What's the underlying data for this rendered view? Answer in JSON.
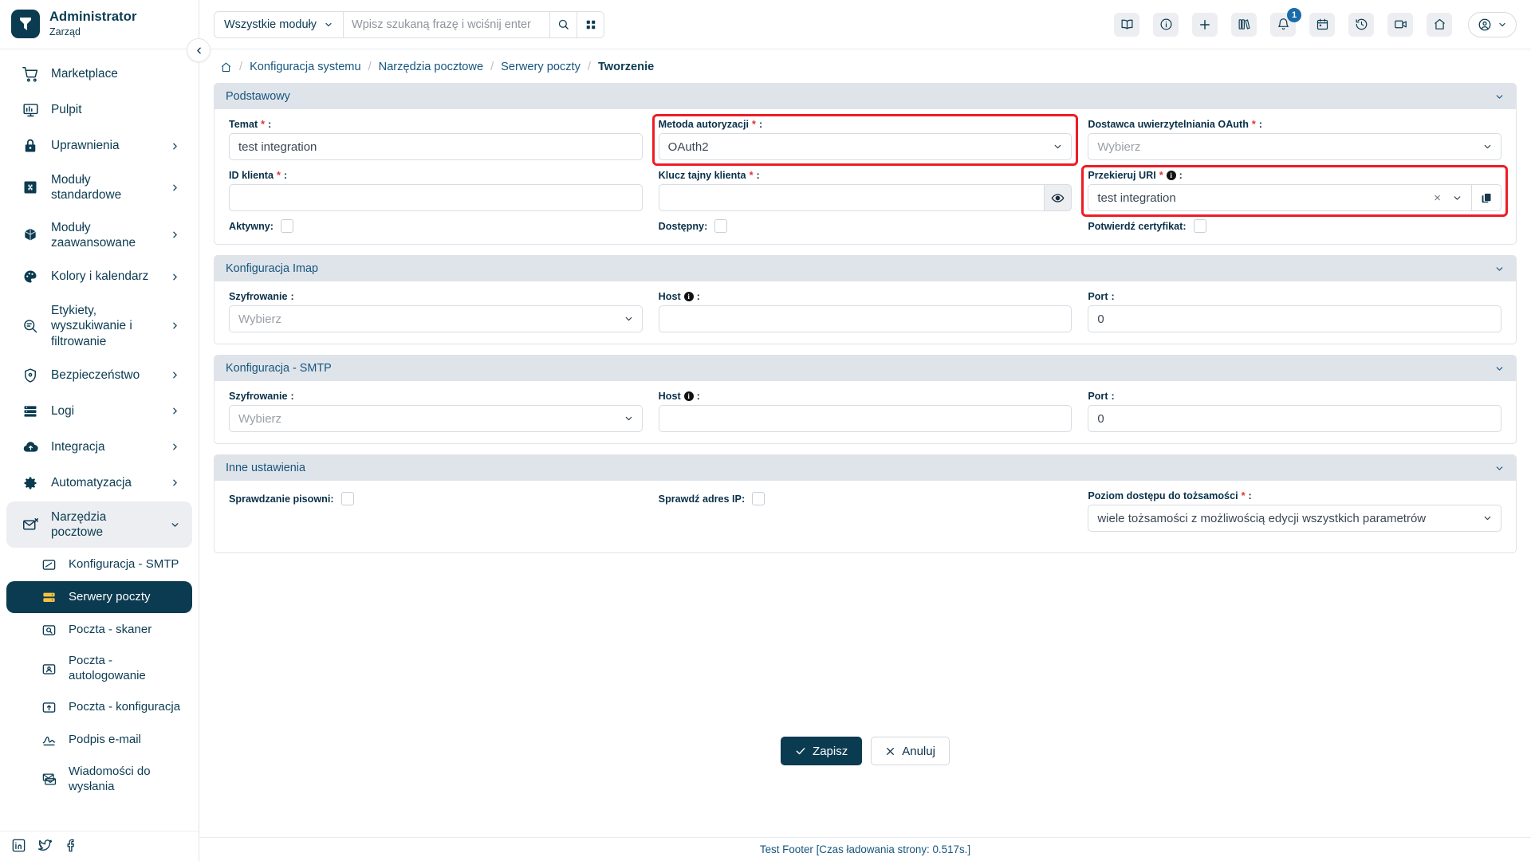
{
  "brand": {
    "name": "Administrator",
    "subtitle": "Zarząd",
    "logo_icon": "yetiforce-logo-icon"
  },
  "sidebar": {
    "collapse_icon": "chevron-left-icon",
    "items": [
      {
        "label": "Marketplace",
        "icon": "shopping-cart-icon",
        "has_children": false
      },
      {
        "label": "Pulpit",
        "icon": "dashboard-icon",
        "has_children": false
      },
      {
        "label": "Uprawnienia",
        "icon": "lock-icon",
        "has_children": true
      },
      {
        "label": "Moduły standardowe",
        "icon": "puzzle-icon",
        "has_children": true
      },
      {
        "label": "Moduły zaawansowane",
        "icon": "cube-icon",
        "has_children": true
      },
      {
        "label": "Kolory i kalendarz",
        "icon": "palette-icon",
        "has_children": true
      },
      {
        "label": "Etykiety, wyszukiwanie i filtrowanie",
        "icon": "search-tag-icon",
        "has_children": true
      },
      {
        "label": "Bezpieczeństwo",
        "icon": "shield-icon",
        "has_children": true
      },
      {
        "label": "Logi",
        "icon": "server-logs-icon",
        "has_children": true
      },
      {
        "label": "Integracja",
        "icon": "cloud-integration-icon",
        "has_children": true
      },
      {
        "label": "Automatyzacja",
        "icon": "gear-icon",
        "has_children": true
      },
      {
        "label": "Narzędzia pocztowe",
        "icon": "mail-tools-icon",
        "has_children": true,
        "expanded": true
      }
    ],
    "subitems": [
      {
        "label": "Konfiguracja - SMTP",
        "icon": "smtp-config-icon",
        "active": false
      },
      {
        "label": "Serwery poczty",
        "icon": "mail-server-icon",
        "active": true
      },
      {
        "label": "Poczta - skaner",
        "icon": "mail-scanner-icon",
        "active": false
      },
      {
        "label": "Poczta - autologowanie",
        "icon": "mail-autologin-icon",
        "active": false
      },
      {
        "label": "Poczta - konfiguracja",
        "icon": "mail-settings-icon",
        "active": false
      },
      {
        "label": "Podpis e-mail",
        "icon": "signature-icon",
        "active": false
      },
      {
        "label": "Wiadomości do wysłania",
        "icon": "outbox-icon",
        "active": false
      }
    ],
    "social": [
      "linkedin-icon",
      "twitter-icon",
      "facebook-icon"
    ]
  },
  "topbar": {
    "module_filter": "Wszystkie moduły",
    "module_filter_caret": "chevron-down-icon",
    "search_placeholder": "Wpisz szukaną frazę i wciśnij enter",
    "search_value": "",
    "search_icon": "search-icon",
    "grid_icon": "grid-icon",
    "icons": [
      {
        "name": "book-icon"
      },
      {
        "name": "info-icon"
      },
      {
        "name": "plus-icon"
      },
      {
        "name": "library-icon"
      },
      {
        "name": "bell-icon",
        "badge": "1"
      },
      {
        "name": "calendar-icon"
      },
      {
        "name": "history-icon"
      },
      {
        "name": "video-icon"
      },
      {
        "name": "home-icon"
      }
    ],
    "user_icon": "user-avatar-icon",
    "user_caret": "chevron-down-icon"
  },
  "breadcrumb": {
    "home_icon": "home-icon",
    "items": [
      "Konfiguracja systemu",
      "Narzędzia pocztowe",
      "Serwery poczty"
    ],
    "current": "Tworzenie"
  },
  "panels": {
    "basic": {
      "title": "Podstawowy",
      "collapse_icon": "chevron-down-icon",
      "subject": {
        "label": "Temat",
        "required": true,
        "value": "test integration"
      },
      "auth_method": {
        "label": "Metoda autoryzacji",
        "required": true,
        "value": "OAuth2",
        "highlighted": true
      },
      "oauth_provider": {
        "label": "Dostawca uwierzytelniania OAuth",
        "required": true,
        "value": "",
        "placeholder": "Wybierz"
      },
      "client_id": {
        "label": "ID klienta",
        "required": true,
        "value": ""
      },
      "client_secret": {
        "label": "Klucz tajny klienta",
        "required": true,
        "value": "",
        "reveal_icon": "eye-icon"
      },
      "redirect_uri": {
        "label": "Przekieruj URI",
        "required": true,
        "info": true,
        "value": "test integration",
        "highlighted": true,
        "clear_icon": "close-x-icon",
        "caret_icon": "chevron-down-icon",
        "copy_icon": "copy-icon"
      },
      "active": {
        "label": "Aktywny",
        "checked": false
      },
      "available": {
        "label": "Dostępny",
        "checked": false
      },
      "verify_cert": {
        "label": "Potwierdź certyfikat",
        "checked": false
      }
    },
    "imap": {
      "title": "Konfiguracja Imap",
      "collapse_icon": "chevron-down-icon",
      "encryption": {
        "label": "Szyfrowanie",
        "value": "",
        "placeholder": "Wybierz"
      },
      "host": {
        "label": "Host",
        "info": true,
        "value": ""
      },
      "port": {
        "label": "Port",
        "value": "0"
      }
    },
    "smtp": {
      "title": "Konfiguracja - SMTP",
      "collapse_icon": "chevron-down-icon",
      "encryption": {
        "label": "Szyfrowanie",
        "value": "",
        "placeholder": "Wybierz"
      },
      "host": {
        "label": "Host",
        "info": true,
        "value": ""
      },
      "port": {
        "label": "Port",
        "value": "0"
      }
    },
    "other": {
      "title": "Inne ustawienia",
      "collapse_icon": "chevron-down-icon",
      "spellcheck": {
        "label": "Sprawdzanie pisowni",
        "checked": false
      },
      "check_ip": {
        "label": "Sprawdź adres IP",
        "checked": false
      },
      "identity_access": {
        "label": "Poziom dostępu do tożsamości",
        "required": true,
        "value": "wiele tożsamości z możliwością edycji wszystkich parametrów"
      }
    }
  },
  "actions": {
    "save": {
      "label": "Zapisz",
      "icon": "check-icon"
    },
    "cancel": {
      "label": "Anuluj",
      "icon": "close-x-icon"
    }
  },
  "footer": {
    "text": "Test Footer [Czas ładowania strony: 0.517s.]"
  },
  "colors": {
    "brand_dark": "#0b3b51",
    "link_blue": "#16557d",
    "highlight_red": "#ee1c25",
    "required_red": "#e03131",
    "panel_head": "#dfe4ea",
    "active_sub_yellow": "#f5c243"
  }
}
